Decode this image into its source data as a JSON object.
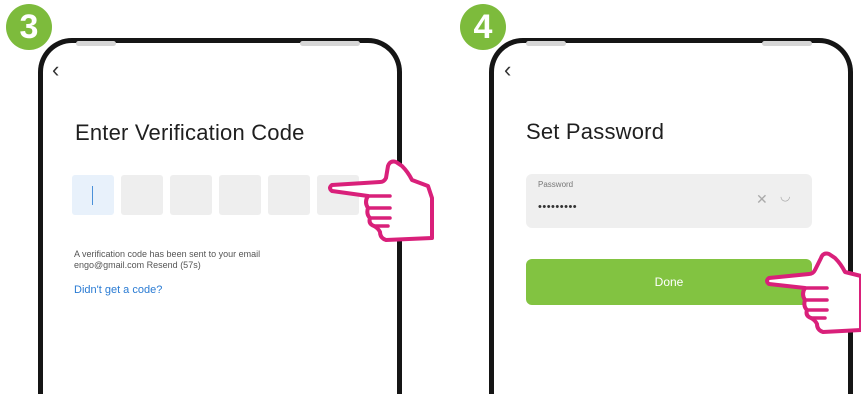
{
  "steps": [
    {
      "number": "3",
      "title": "Enter Verification Code",
      "code_boxes": [
        "",
        "",
        "",
        "",
        "",
        ""
      ],
      "info_line1": "A verification code has been sent to your email",
      "info_line2": "engo@gmail.com Resend (57s)",
      "link": "Didn't get a code?"
    },
    {
      "number": "4",
      "title": "Set Password",
      "password_label": "Password",
      "password_value": "•••••••••",
      "button_label": "Done"
    }
  ],
  "colors": {
    "badge": "#7dbb3c",
    "button": "#82c341",
    "hand_outline": "#d9207a",
    "link": "#2a7bd3"
  },
  "icons": {
    "back": "chevron-left-icon",
    "clear": "close-icon",
    "visibility": "eye-hidden-icon",
    "pointer": "pointing-hand-icon"
  }
}
